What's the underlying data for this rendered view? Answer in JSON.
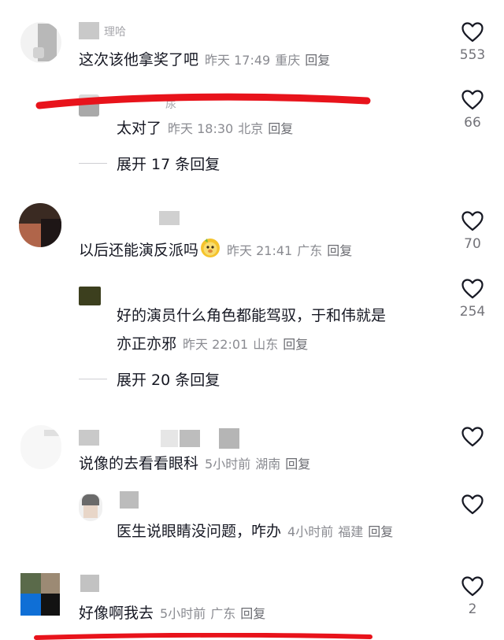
{
  "comments": [
    {
      "name_fragment": "理哈",
      "text": "这次该他拿奖了吧",
      "time": "昨天 17:49",
      "location": "重庆",
      "reply_label": "回复",
      "likes": "553"
    },
    {
      "name_fragment": "尿",
      "text": "太对了",
      "time": "昨天 18:30",
      "location": "北京",
      "reply_label": "回复",
      "likes": "66"
    },
    {
      "expand_label": "展开 17 条回复"
    },
    {
      "text": "以后还能演反派吗",
      "emoji": "lion-face-emoji",
      "time": "昨天 21:41",
      "location": "广东",
      "reply_label": "回复",
      "likes": "70"
    },
    {
      "text_line1": "好的演员什么角色都能驾驭，于和伟就是",
      "text_line2": "亦正亦邪",
      "time": "昨天 22:01",
      "location": "山东",
      "reply_label": "回复",
      "likes": "254"
    },
    {
      "expand_label": "展开 20 条回复"
    },
    {
      "text": "说像的去看看眼科",
      "time": "5小时前",
      "location": "湖南",
      "reply_label": "回复",
      "likes": ""
    },
    {
      "text": "医生说眼睛没问题，咋办",
      "time": "4小时前",
      "location": "福建",
      "reply_label": "回复",
      "likes": ""
    },
    {
      "text": "好像啊我去",
      "time": "5小时前",
      "location": "广东",
      "reply_label": "回复",
      "likes": "2"
    }
  ],
  "colors": {
    "text": "#161823",
    "meta": "#8a8b91",
    "annotation_red": "#e8131b"
  },
  "icons": {
    "like": "heart-outline-icon"
  }
}
